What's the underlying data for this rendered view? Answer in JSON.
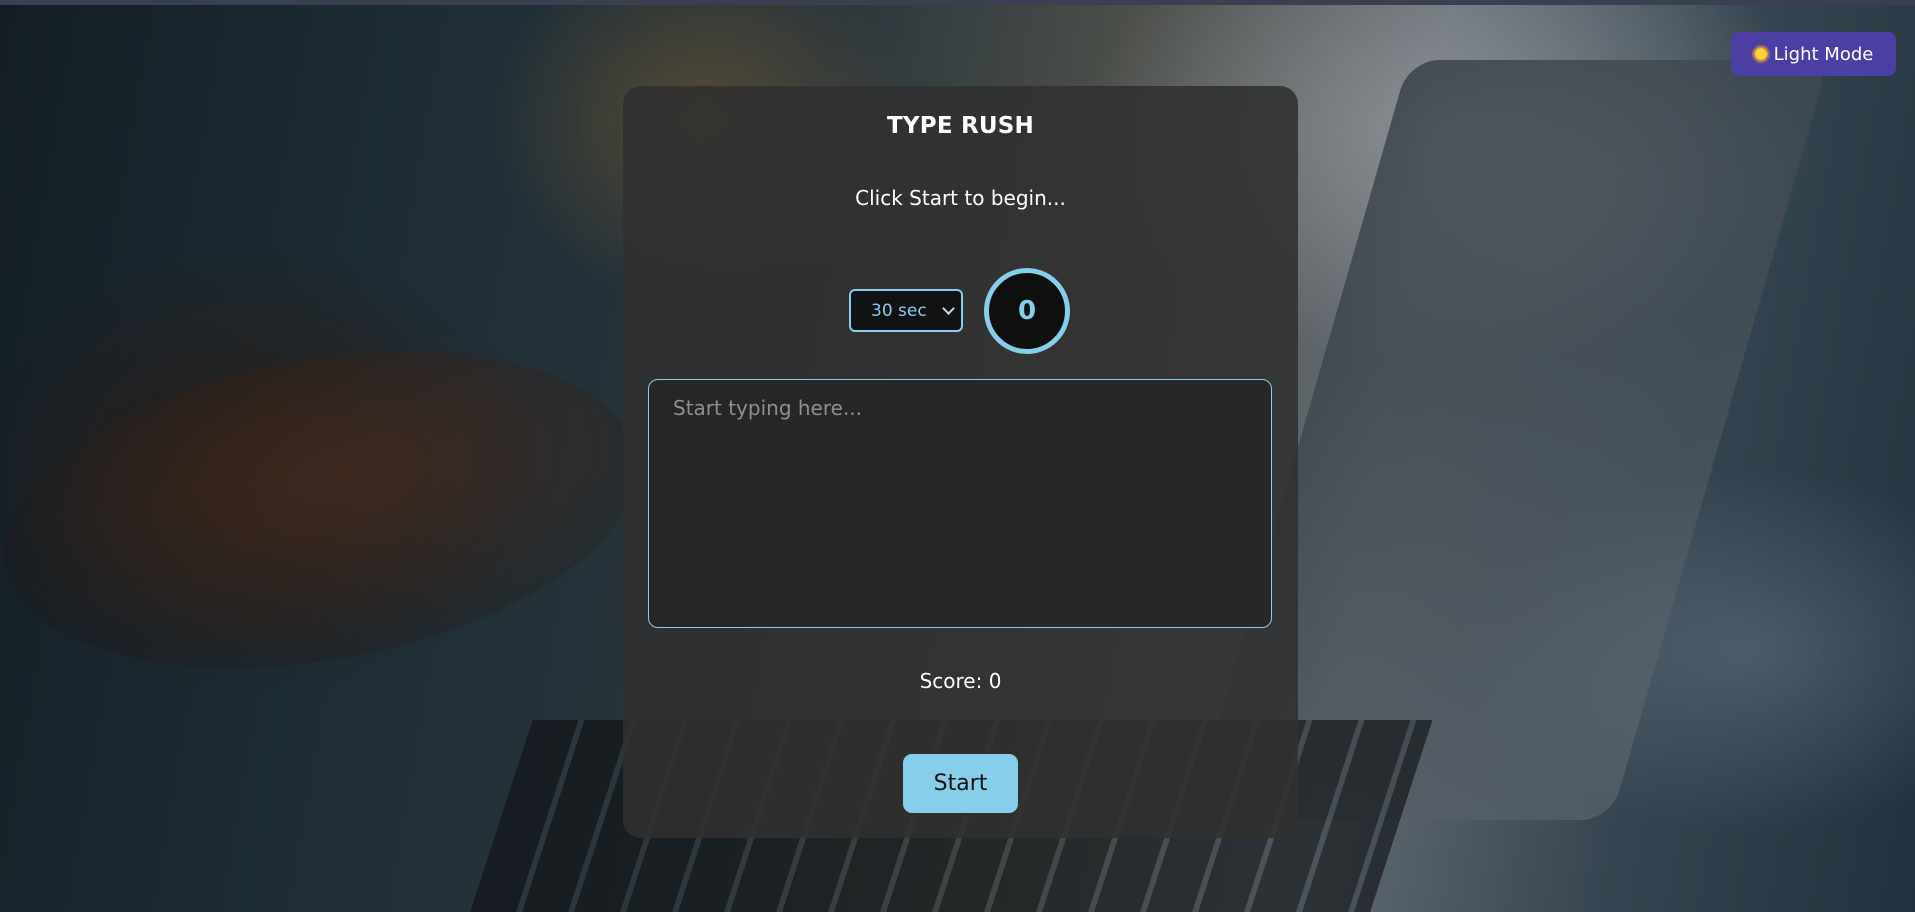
{
  "theme_toggle": {
    "icon": "sun-icon",
    "label": "Light Mode",
    "color": "#4b3fa3"
  },
  "game": {
    "title": "TYPE RUSH",
    "prompt": "Click Start to begin...",
    "duration": {
      "selected": "30 sec"
    },
    "timer_value": "0",
    "typing_area": {
      "placeholder": "Start typing here...",
      "value": ""
    },
    "score": "Score: 0",
    "start_label": "Start",
    "accent_color": "#87ceeb"
  }
}
